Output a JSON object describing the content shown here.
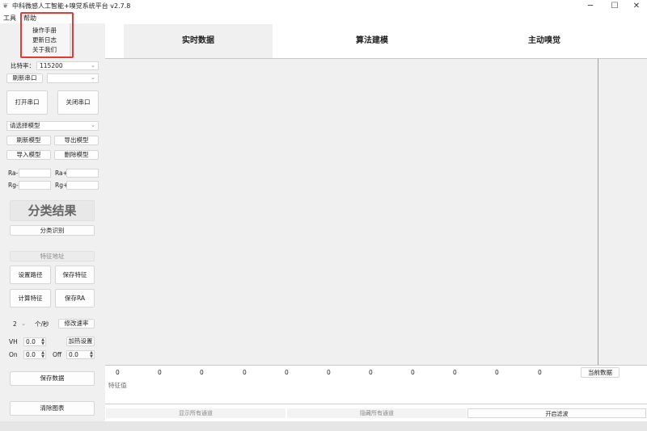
{
  "titlebar": {
    "title": "中科微感人工智能+嗅觉系统平台 v2.7.8",
    "app_icon": "leaf-logo-icon",
    "minimize": "─",
    "maximize": "☐",
    "close": "✕"
  },
  "menu": {
    "tools": "工具",
    "help": "帮助",
    "help_items": [
      "操作手册",
      "更新日志",
      "关于我们"
    ]
  },
  "sidebar": {
    "baud_label": "比特率：",
    "baud_value": "115200",
    "refresh_port": "刷新串口",
    "port_value": "",
    "open_port": "打开串口",
    "close_port": "关闭串口",
    "model_select": "请选择模型",
    "refresh_model": "刷新模型",
    "export_model": "导出模型",
    "import_model": "导入模型",
    "delete_model": "删除模型",
    "ra_minus": "Ra-",
    "ra_plus": "Ra+",
    "rg_minus": "Rg-",
    "rg_plus": "Rg+",
    "result_title": "分类结果",
    "classify_btn": "分类识别",
    "feature_addr": "特征地址",
    "set_path": "设置路径",
    "save_feature": "保存特征",
    "calc_feature": "计算特征",
    "save_ra": "保存RA",
    "rate_value": "2",
    "rate_unit": "个/秒",
    "change_rate": "修改速率",
    "vh_label": "VH",
    "vh_value": "0.0",
    "heat_settings": "加热设置",
    "on_label": "On",
    "on_value": "0.0",
    "off_label": "Off",
    "off_value": "0.0",
    "save_data": "保存数据",
    "clear_chart": "清除图表"
  },
  "tabs": [
    "实时数据",
    "算法建模",
    "主动嗅觉"
  ],
  "readout": {
    "values": [
      "0",
      "0",
      "0",
      "0",
      "0",
      "0",
      "0",
      "0",
      "0",
      "0",
      "0"
    ],
    "current_data": "当前数据",
    "feature_label": "特征值"
  },
  "bottom": {
    "show_all": "显示所有通道",
    "hide_all": "隐藏所有通道",
    "filter": "开启滤波"
  }
}
